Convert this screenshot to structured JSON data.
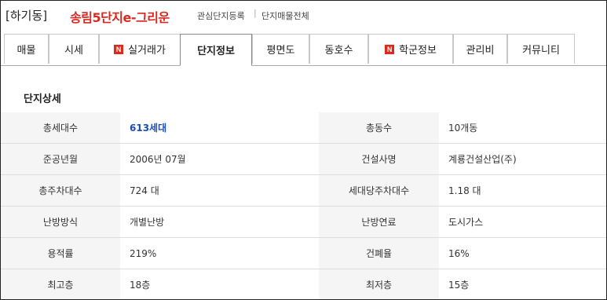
{
  "header": {
    "district": "[하기동]",
    "apt_name": "송림5단지e-그리운",
    "link_register": "관심단지등록",
    "separator": "|",
    "link_all_listings": "단지매물전체"
  },
  "tabs": [
    {
      "label": "매물",
      "badge": ""
    },
    {
      "label": "시세",
      "badge": ""
    },
    {
      "label": "실거래가",
      "badge": "N"
    },
    {
      "label": "단지정보",
      "badge": ""
    },
    {
      "label": "평면도",
      "badge": ""
    },
    {
      "label": "동호수",
      "badge": ""
    },
    {
      "label": "학군정보",
      "badge": "N"
    },
    {
      "label": "관리비",
      "badge": ""
    },
    {
      "label": "커뮤니티",
      "badge": ""
    }
  ],
  "active_tab": "단지정보",
  "section_title": "단지상세",
  "rows": [
    {
      "l1": "총세대수",
      "v1": "613세대",
      "l2": "총동수",
      "v2": "10개동"
    },
    {
      "l1": "준공년월",
      "v1": "2006년 07월",
      "l2": "건설사명",
      "v2": "계룡건설산업(주)"
    },
    {
      "l1": "총주차대수",
      "v1": "724 대",
      "l2": "세대당주차대수",
      "v2": "1.18 대"
    },
    {
      "l1": "난방방식",
      "v1": "개별난방",
      "l2": "난방연료",
      "v2": "도시가스"
    },
    {
      "l1": "용적률",
      "v1": "219%",
      "l2": "건폐율",
      "v2": "16%"
    },
    {
      "l1": "최고층",
      "v1": "18층",
      "l2": "최저층",
      "v2": "15층"
    }
  ],
  "colors": {
    "accent_red": "#d8281f",
    "link_blue": "#1a4fb5",
    "label_bg": "#f5f5f5"
  }
}
